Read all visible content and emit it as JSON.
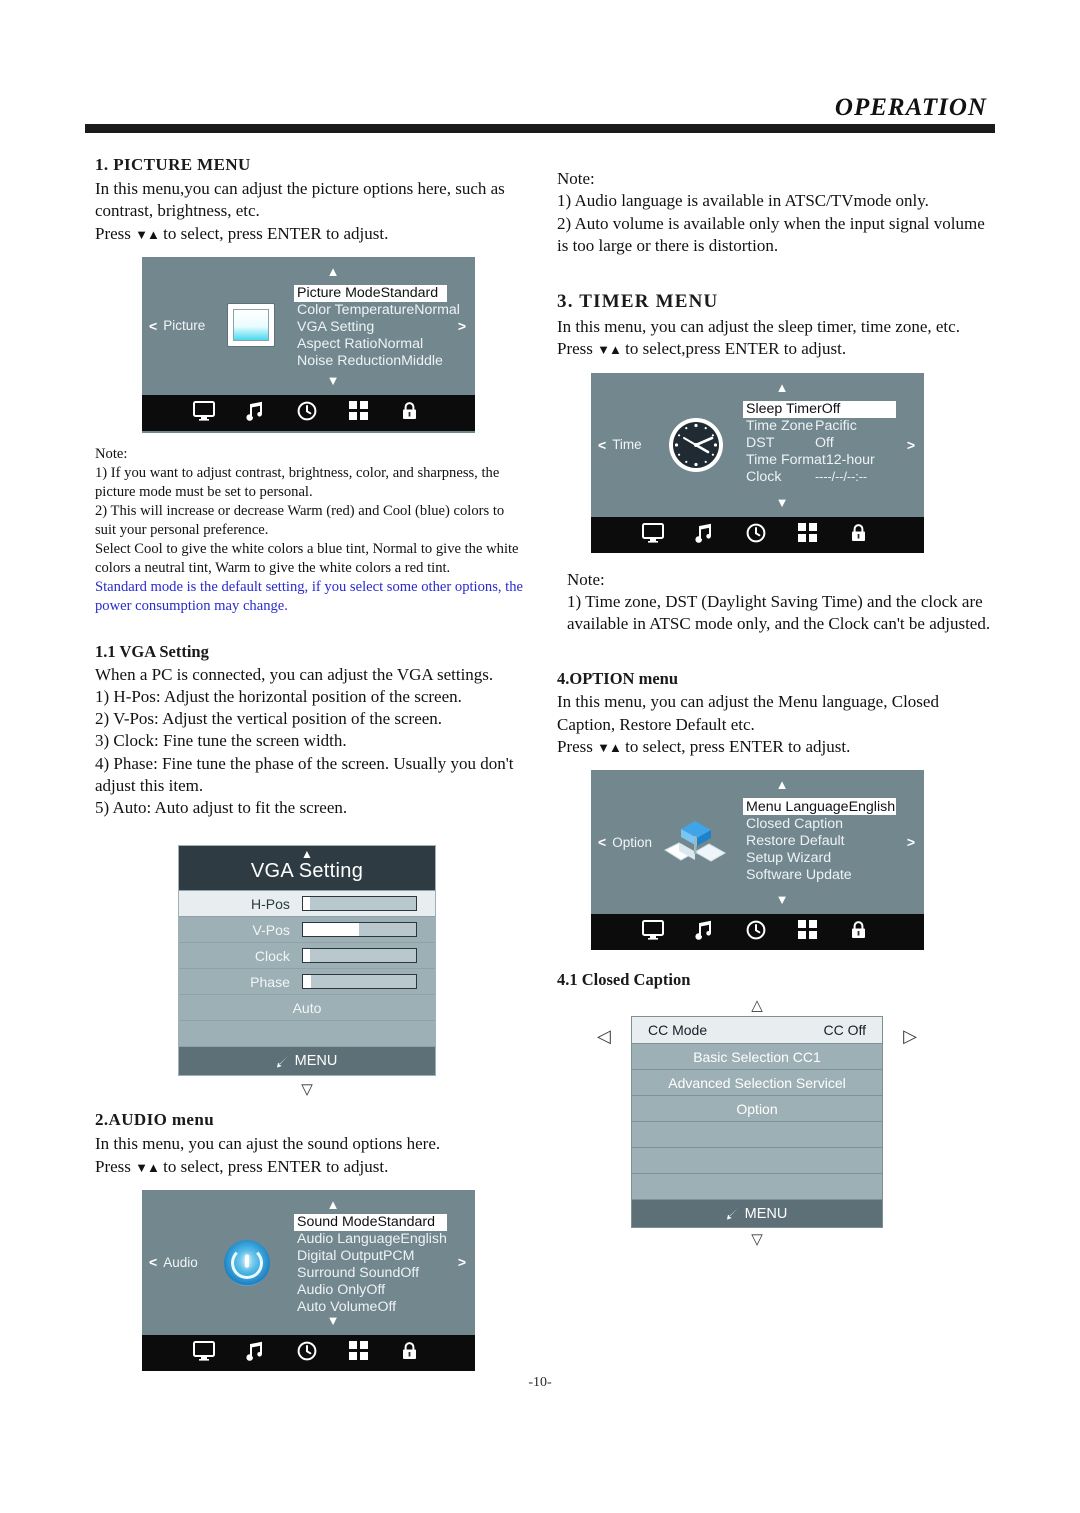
{
  "header": {
    "title": "OPERATION"
  },
  "page_number": "-10-",
  "left": {
    "picture": {
      "heading": "1. PICTURE MENU",
      "para": "In this menu,you can adjust the picture options here, such as contrast, brightness, etc.",
      "press_pre": "Press ",
      "press_arrows": "▼▲",
      "press_post": " to select, press ENTER to adjust."
    },
    "picture_osd": {
      "category": "Picture",
      "left_arrow": "<",
      "right_arrow": ">",
      "up_arrow": "▲",
      "down_arrow": "▼",
      "rows": [
        {
          "label": "Picture Mode",
          "value": "Standard",
          "selected": true
        },
        {
          "label": "Color Temperature",
          "value": "Normal",
          "selected": false
        },
        {
          "label": "VGA Setting",
          "value": "",
          "selected": false
        },
        {
          "label": "Aspect Ratio",
          "value": "Normal",
          "selected": false
        },
        {
          "label": "Noise Reduction",
          "value": "Middle",
          "selected": false
        }
      ],
      "tabs": [
        "monitor-icon",
        "music-note-icon",
        "clock-icon",
        "grid-icon",
        "lock-icon"
      ]
    },
    "picture_note": {
      "title": "Note:",
      "lines": [
        "1) If you want to adjust contrast, brightness, color, and sharpness, the picture mode must be set to personal.",
        "2) This will increase or decrease Warm (red) and Cool (blue) colors to suit your personal preference.",
        "Select Cool to give the white colors a blue tint, Normal to give the white colors a neutral tint, Warm to give the white colors a red tint."
      ],
      "blue_line": "Standard mode is the default setting, if you select some other options, the power consumption may change."
    },
    "vga": {
      "heading": "1.1 VGA Setting",
      "intro": "When a PC is connected, you can adjust the VGA settings.",
      "items": [
        "1) H-Pos: Adjust the horizontal position of the screen.",
        "2) V-Pos: Adjust the vertical position of the screen.",
        "3) Clock: Fine tune the screen width.",
        "4) Phase: Fine tune the phase of the screen. Usually  you don't adjust this item.",
        "5) Auto: Auto adjust to fit the screen."
      ]
    },
    "vga_osd": {
      "title": "VGA Setting",
      "up_arrow": "▲",
      "down_arrow": "▽",
      "rows": [
        {
          "label": "H-Pos",
          "fill": 6,
          "highlight": true
        },
        {
          "label": "V-Pos",
          "fill": 50,
          "highlight": false
        },
        {
          "label": "Clock",
          "fill": 6,
          "highlight": false
        },
        {
          "label": "Phase",
          "fill": 7,
          "highlight": false
        }
      ],
      "auto_label": "Auto",
      "menu_label": "MENU",
      "menu_icon": "return-arrow-icon"
    },
    "audio": {
      "heading": "2.AUDIO menu",
      "para": "In this menu, you can ajust the sound options here.",
      "press_pre": "Press ",
      "press_arrows": "▼▲",
      "press_post": " to select, press ENTER to adjust."
    },
    "audio_osd": {
      "category": "Audio",
      "left_arrow": "<",
      "right_arrow": ">",
      "up_arrow": "▲",
      "down_arrow": "▼",
      "rows": [
        {
          "label": "Sound Mode",
          "value": "Standard",
          "selected": true
        },
        {
          "label": "Audio Language",
          "value": "English",
          "selected": false
        },
        {
          "label": "Digital Output",
          "value": "PCM",
          "selected": false
        },
        {
          "label": "Surround Sound",
          "value": "Off",
          "selected": false
        },
        {
          "label": "Audio Only",
          "value": "Off",
          "selected": false
        },
        {
          "label": "Auto Volume",
          "value": "Off",
          "selected": false
        }
      ],
      "tabs": [
        "monitor-icon",
        "music-note-icon",
        "clock-icon",
        "grid-icon",
        "lock-icon"
      ]
    }
  },
  "right": {
    "audio_note": {
      "title": "Note:",
      "lines": [
        "1) Audio language is available in ATSC/TVmode only.",
        "2) Auto volume is available only when the input signal volume is too large or there is distortion."
      ]
    },
    "timer": {
      "heading": "3. TIMER MENU",
      "para_pre": "In this menu, you can adjust the sleep timer, time zone, etc. Press ",
      "para_arrows": "▼▲",
      "para_post": " to select,press ENTER to adjust."
    },
    "timer_osd": {
      "category": "Time",
      "left_arrow": "<",
      "right_arrow": ">",
      "up_arrow": "▲",
      "down_arrow": "▼",
      "rows": [
        {
          "label": "Sleep Timer",
          "value": "Off",
          "selected": true
        },
        {
          "label": "Time Zone",
          "value": "Pacific",
          "selected": false
        },
        {
          "label": "DST",
          "value": "Off",
          "selected": false
        },
        {
          "label": "Time Format",
          "value": "12-hour",
          "selected": false
        },
        {
          "label": "Clock",
          "value": "----/--/--:--",
          "selected": false
        }
      ],
      "tabs": [
        "monitor-icon",
        "music-note-icon",
        "clock-icon",
        "grid-icon",
        "lock-icon"
      ]
    },
    "timer_note": {
      "title": "Note:",
      "lines": [
        "1) Time zone, DST (Daylight Saving Time) and the clock are available in ATSC mode only, and the Clock can't be adjusted."
      ]
    },
    "option": {
      "heading": "4.OPTION menu",
      "para": "In this menu, you can adjust the Menu language, Closed Caption, Restore Default etc.",
      "press_pre": "Press ",
      "press_arrows": "▼▲",
      "press_post": " to select, press ENTER to adjust."
    },
    "option_osd": {
      "category": "Option",
      "left_arrow": "<",
      "right_arrow": ">",
      "up_arrow": "▲",
      "down_arrow": "▼",
      "rows": [
        {
          "label": "Menu Language",
          "value": "English",
          "selected": true
        },
        {
          "label": "Closed Caption",
          "value": "",
          "selected": false
        },
        {
          "label": "Restore Default",
          "value": "",
          "selected": false
        },
        {
          "label": "Setup Wizard",
          "value": "",
          "selected": false
        },
        {
          "label": "Software Update",
          "value": "",
          "selected": false
        }
      ],
      "tabs": [
        "monitor-icon",
        "music-note-icon",
        "clock-icon",
        "grid-icon",
        "lock-icon"
      ]
    },
    "cc": {
      "heading": "4.1 Closed Caption"
    },
    "cc_osd": {
      "up_arrow": "△",
      "down_arrow": "▽",
      "left_arrow": "◁",
      "right_arrow": "▷",
      "top_label": "CC Mode",
      "top_value": "CC Off",
      "rows": [
        "Basic Selection CC1",
        "Advanced Selection Servicel",
        "Option",
        "",
        "",
        ""
      ],
      "menu_label": "MENU",
      "menu_icon": "return-arrow-icon"
    }
  }
}
